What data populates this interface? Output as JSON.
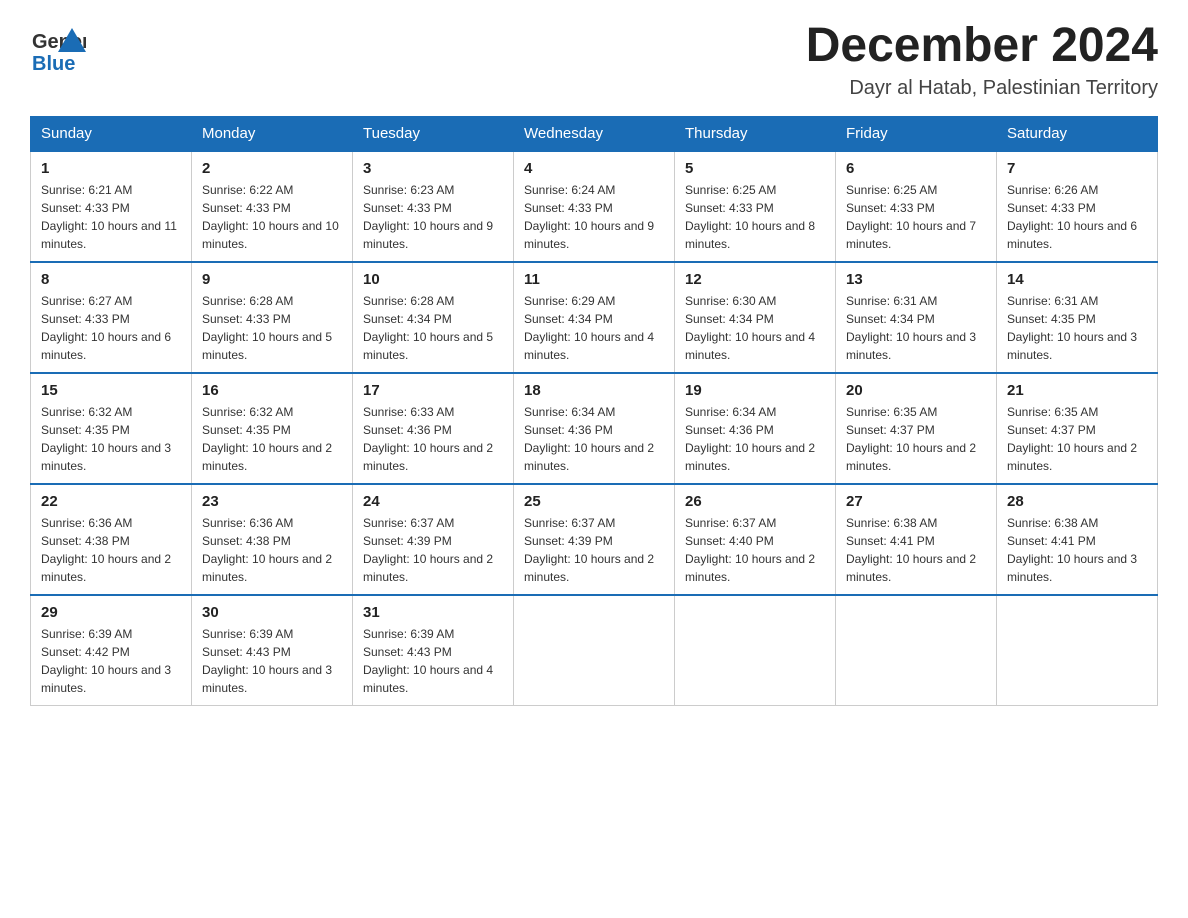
{
  "header": {
    "logo_general": "General",
    "logo_blue": "Blue",
    "month_year": "December 2024",
    "location": "Dayr al Hatab, Palestinian Territory"
  },
  "days_of_week": [
    "Sunday",
    "Monday",
    "Tuesday",
    "Wednesday",
    "Thursday",
    "Friday",
    "Saturday"
  ],
  "weeks": [
    [
      {
        "day": "1",
        "sunrise": "6:21 AM",
        "sunset": "4:33 PM",
        "daylight": "10 hours and 11 minutes."
      },
      {
        "day": "2",
        "sunrise": "6:22 AM",
        "sunset": "4:33 PM",
        "daylight": "10 hours and 10 minutes."
      },
      {
        "day": "3",
        "sunrise": "6:23 AM",
        "sunset": "4:33 PM",
        "daylight": "10 hours and 9 minutes."
      },
      {
        "day": "4",
        "sunrise": "6:24 AM",
        "sunset": "4:33 PM",
        "daylight": "10 hours and 9 minutes."
      },
      {
        "day": "5",
        "sunrise": "6:25 AM",
        "sunset": "4:33 PM",
        "daylight": "10 hours and 8 minutes."
      },
      {
        "day": "6",
        "sunrise": "6:25 AM",
        "sunset": "4:33 PM",
        "daylight": "10 hours and 7 minutes."
      },
      {
        "day": "7",
        "sunrise": "6:26 AM",
        "sunset": "4:33 PM",
        "daylight": "10 hours and 6 minutes."
      }
    ],
    [
      {
        "day": "8",
        "sunrise": "6:27 AM",
        "sunset": "4:33 PM",
        "daylight": "10 hours and 6 minutes."
      },
      {
        "day": "9",
        "sunrise": "6:28 AM",
        "sunset": "4:33 PM",
        "daylight": "10 hours and 5 minutes."
      },
      {
        "day": "10",
        "sunrise": "6:28 AM",
        "sunset": "4:34 PM",
        "daylight": "10 hours and 5 minutes."
      },
      {
        "day": "11",
        "sunrise": "6:29 AM",
        "sunset": "4:34 PM",
        "daylight": "10 hours and 4 minutes."
      },
      {
        "day": "12",
        "sunrise": "6:30 AM",
        "sunset": "4:34 PM",
        "daylight": "10 hours and 4 minutes."
      },
      {
        "day": "13",
        "sunrise": "6:31 AM",
        "sunset": "4:34 PM",
        "daylight": "10 hours and 3 minutes."
      },
      {
        "day": "14",
        "sunrise": "6:31 AM",
        "sunset": "4:35 PM",
        "daylight": "10 hours and 3 minutes."
      }
    ],
    [
      {
        "day": "15",
        "sunrise": "6:32 AM",
        "sunset": "4:35 PM",
        "daylight": "10 hours and 3 minutes."
      },
      {
        "day": "16",
        "sunrise": "6:32 AM",
        "sunset": "4:35 PM",
        "daylight": "10 hours and 2 minutes."
      },
      {
        "day": "17",
        "sunrise": "6:33 AM",
        "sunset": "4:36 PM",
        "daylight": "10 hours and 2 minutes."
      },
      {
        "day": "18",
        "sunrise": "6:34 AM",
        "sunset": "4:36 PM",
        "daylight": "10 hours and 2 minutes."
      },
      {
        "day": "19",
        "sunrise": "6:34 AM",
        "sunset": "4:36 PM",
        "daylight": "10 hours and 2 minutes."
      },
      {
        "day": "20",
        "sunrise": "6:35 AM",
        "sunset": "4:37 PM",
        "daylight": "10 hours and 2 minutes."
      },
      {
        "day": "21",
        "sunrise": "6:35 AM",
        "sunset": "4:37 PM",
        "daylight": "10 hours and 2 minutes."
      }
    ],
    [
      {
        "day": "22",
        "sunrise": "6:36 AM",
        "sunset": "4:38 PM",
        "daylight": "10 hours and 2 minutes."
      },
      {
        "day": "23",
        "sunrise": "6:36 AM",
        "sunset": "4:38 PM",
        "daylight": "10 hours and 2 minutes."
      },
      {
        "day": "24",
        "sunrise": "6:37 AM",
        "sunset": "4:39 PM",
        "daylight": "10 hours and 2 minutes."
      },
      {
        "day": "25",
        "sunrise": "6:37 AM",
        "sunset": "4:39 PM",
        "daylight": "10 hours and 2 minutes."
      },
      {
        "day": "26",
        "sunrise": "6:37 AM",
        "sunset": "4:40 PM",
        "daylight": "10 hours and 2 minutes."
      },
      {
        "day": "27",
        "sunrise": "6:38 AM",
        "sunset": "4:41 PM",
        "daylight": "10 hours and 2 minutes."
      },
      {
        "day": "28",
        "sunrise": "6:38 AM",
        "sunset": "4:41 PM",
        "daylight": "10 hours and 3 minutes."
      }
    ],
    [
      {
        "day": "29",
        "sunrise": "6:39 AM",
        "sunset": "4:42 PM",
        "daylight": "10 hours and 3 minutes."
      },
      {
        "day": "30",
        "sunrise": "6:39 AM",
        "sunset": "4:43 PM",
        "daylight": "10 hours and 3 minutes."
      },
      {
        "day": "31",
        "sunrise": "6:39 AM",
        "sunset": "4:43 PM",
        "daylight": "10 hours and 4 minutes."
      },
      null,
      null,
      null,
      null
    ]
  ],
  "labels": {
    "sunrise_prefix": "Sunrise: ",
    "sunset_prefix": "Sunset: ",
    "daylight_prefix": "Daylight: "
  }
}
